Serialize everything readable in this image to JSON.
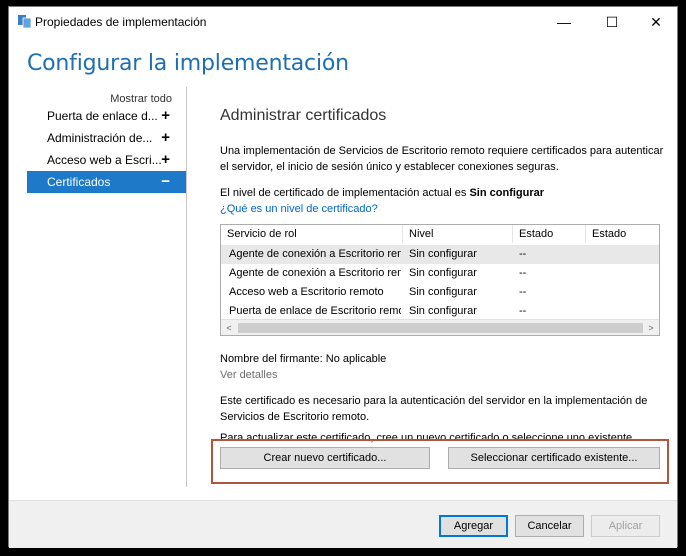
{
  "window": {
    "title": "Propiedades de implementación",
    "controls": {
      "minimize": "—",
      "maximize": "☐",
      "close": "✕"
    }
  },
  "heading": "Configurar la implementación",
  "nav": {
    "show_all": "Mostrar todo",
    "items": [
      {
        "label": "Puerta de enlace d...",
        "sign": "+",
        "active": false
      },
      {
        "label": "Administración de...",
        "sign": "+",
        "active": false
      },
      {
        "label": "Acceso web a Escri...",
        "sign": "+",
        "active": false
      },
      {
        "label": "Certificados",
        "sign": "−",
        "active": true
      }
    ]
  },
  "content": {
    "title": "Administrar certificados",
    "description": "Una implementación de Servicios de Escritorio remoto requiere certificados para autenticar el servidor, el inicio de sesión único y establecer conexiones seguras.",
    "level_prefix": "El nivel de certificado de implementación actual es ",
    "level_value": "Sin configurar",
    "level_link": "¿Qué es un nivel de certificado?",
    "table": {
      "columns": [
        "Servicio de rol",
        "Nivel",
        "Estado",
        "Estado"
      ],
      "rows": [
        {
          "role": "Agente de conexión a Escritorio ren",
          "level": "Sin configurar",
          "status": "--",
          "status2": ""
        },
        {
          "role": "Agente de conexión a Escritorio ren",
          "level": "Sin configurar",
          "status": "--",
          "status2": ""
        },
        {
          "role": "Acceso web a Escritorio remoto",
          "level": "Sin configurar",
          "status": "--",
          "status2": ""
        },
        {
          "role": "Puerta de enlace de Escritorio remo",
          "level": "Sin configurar",
          "status": "--",
          "status2": ""
        }
      ],
      "scroll_left": "<",
      "scroll_right": ">"
    },
    "signer": "Nombre del firmante: No aplicable",
    "details_link": "Ver detalles",
    "note": "Este certificado es necesario para la autenticación del servidor en la implementación de Servicios de Escritorio remoto.",
    "update_note": "Para actualizar este certificado, cree un nuevo certificado o seleccione uno existente.",
    "create_button": "Crear nuevo certificado...",
    "select_button": "Seleccionar certificado existente..."
  },
  "footer": {
    "apply_label": "Agregar",
    "cancel_label": "Cancelar",
    "aplicar_label": "Aplicar"
  },
  "colors": {
    "accent": "#1e7ac8",
    "heading": "#1e6fb0",
    "highlight": "#b0563c",
    "link": "#0066cc"
  }
}
